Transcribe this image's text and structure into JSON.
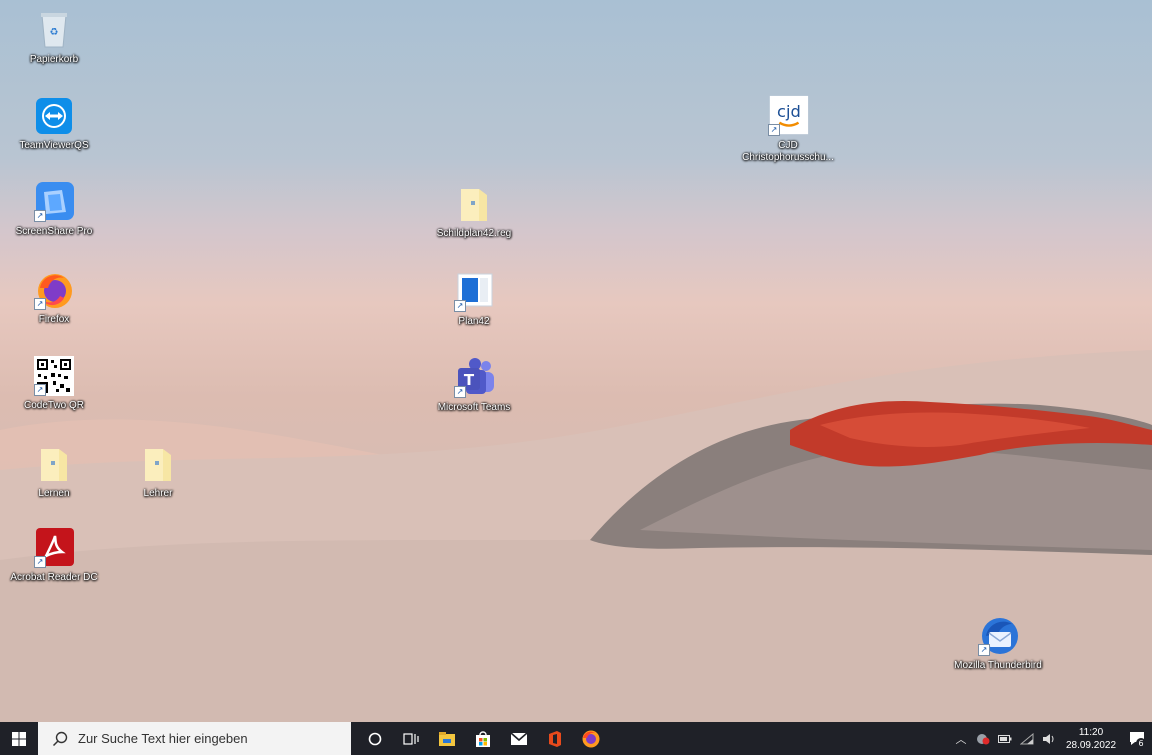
{
  "desktop": {
    "icons": [
      {
        "label": "Papierkorb",
        "icon": "recycle-bin-icon"
      },
      {
        "label": "TeamViewerQS",
        "icon": "teamviewer-icon"
      },
      {
        "label": "ScreenShare Pro",
        "icon": "screenshare-icon"
      },
      {
        "label": "Firefox",
        "icon": "firefox-icon"
      },
      {
        "label": "CodeTwo QR",
        "icon": "qr-code-icon"
      },
      {
        "label": "Lernen",
        "icon": "folder-icon"
      },
      {
        "label": "Lehrer",
        "icon": "folder-icon"
      },
      {
        "label": "Acrobat Reader DC",
        "icon": "acrobat-icon"
      },
      {
        "label": "Schildplan42.reg",
        "icon": "reg-file-icon"
      },
      {
        "label": "Plan42",
        "icon": "plan42-icon"
      },
      {
        "label": "Microsoft Teams",
        "icon": "teams-icon"
      },
      {
        "label": "CJD",
        "label2": "Christophorusschu...",
        "icon": "cjd-logo-icon",
        "logo_text": "cjd"
      },
      {
        "label": "Mozilla Thunderbird",
        "icon": "thunderbird-icon"
      }
    ]
  },
  "taskbar": {
    "search_placeholder": "Zur Suche Text hier eingeben",
    "clock_time": "11:20",
    "clock_date": "28.09.2022",
    "notification_count": "6",
    "apps": [
      "cortana-icon",
      "task-view-icon",
      "file-explorer-icon",
      "store-icon",
      "mail-icon",
      "office-icon",
      "firefox-icon"
    ]
  },
  "colors": {
    "taskbar": "#1f2128",
    "search_bg": "#f3f3f3"
  }
}
